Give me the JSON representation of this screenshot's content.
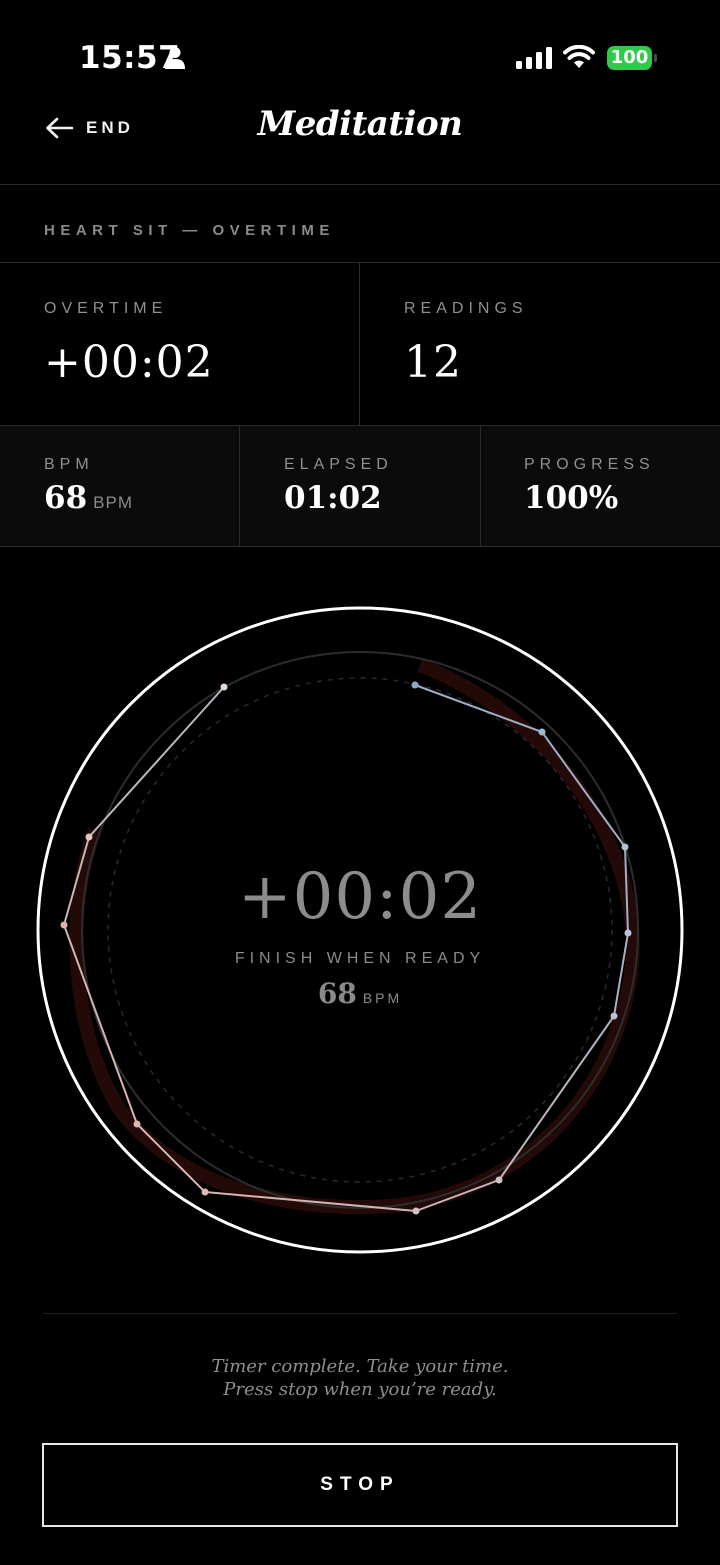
{
  "status_bar": {
    "time": "15:57",
    "battery": "100",
    "colors": {
      "battery": "#30c94a"
    },
    "icons": [
      "person-icon",
      "signal-icon",
      "wifi-icon"
    ]
  },
  "header": {
    "back_label": "END",
    "title": "Meditation"
  },
  "session": {
    "label": "HEART SIT — OVERTIME"
  },
  "stats": {
    "overtime": {
      "label": "OVERTIME",
      "value": "+00:02"
    },
    "readings": {
      "label": "READINGS",
      "value": "12"
    },
    "bpm": {
      "label": "BPM",
      "value": "68",
      "unit": "BPM"
    },
    "elapsed": {
      "label": "ELAPSED",
      "value": "01:02"
    },
    "progress": {
      "label": "PROGRESS",
      "value": "100%",
      "fraction": 1.0
    }
  },
  "dial": {
    "time": "+00:02",
    "message": "FINISH WHEN READY",
    "bpm": "68",
    "bpm_unit": "BPM",
    "reading_count": 12,
    "colors": {
      "ring": "#ffffff",
      "trace_start": "#8fa9c8",
      "trace_end": "#e0b2aa"
    }
  },
  "note": {
    "line1": "Timer complete. Take your time.",
    "line2": "Press stop when you’re ready."
  },
  "stop_label": "STOP"
}
